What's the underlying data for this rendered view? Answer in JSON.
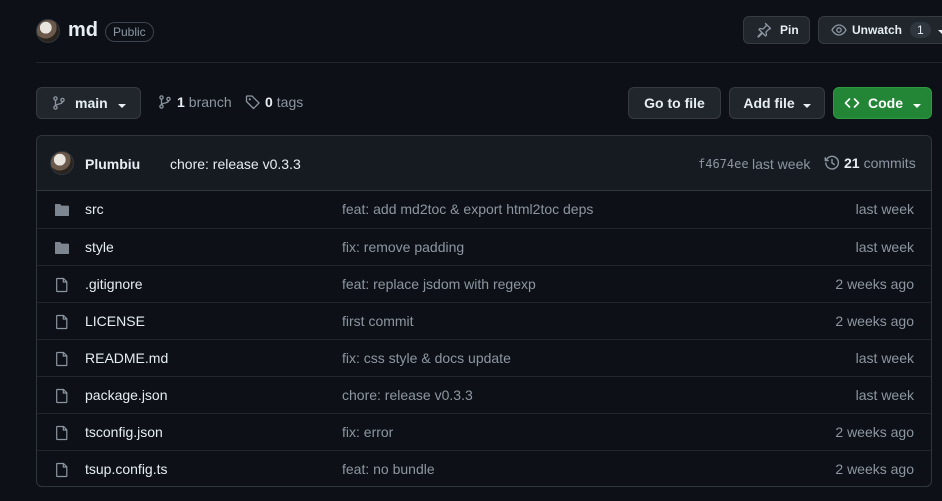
{
  "repo": {
    "name": "md",
    "visibility": "Public"
  },
  "header_actions": {
    "pin_label": "Pin",
    "unwatch_label": "Unwatch",
    "watch_count": "1"
  },
  "toolbar": {
    "branch_selector": "main",
    "branches_count": "1",
    "branches_label": "branch",
    "tags_count": "0",
    "tags_label": "tags",
    "go_to_file": "Go to file",
    "add_file": "Add file",
    "code": "Code"
  },
  "latest_commit": {
    "author": "Plumbiu",
    "message": "chore: release v0.3.3",
    "sha": "f4674ee",
    "age": "last week",
    "commits_count": "21",
    "commits_label": "commits"
  },
  "files": [
    {
      "type": "dir",
      "name": "src",
      "message": "feat: add md2toc & export html2toc deps",
      "age": "last week"
    },
    {
      "type": "dir",
      "name": "style",
      "message": "fix: remove padding",
      "age": "last week"
    },
    {
      "type": "file",
      "name": ".gitignore",
      "message": "feat: replace jsdom with regexp",
      "age": "2 weeks ago"
    },
    {
      "type": "file",
      "name": "LICENSE",
      "message": "first commit",
      "age": "2 weeks ago"
    },
    {
      "type": "file",
      "name": "README.md",
      "message": "fix: css style & docs update",
      "age": "last week"
    },
    {
      "type": "file",
      "name": "package.json",
      "message": "chore: release v0.3.3",
      "age": "last week"
    },
    {
      "type": "file",
      "name": "tsconfig.json",
      "message": "fix: error",
      "age": "2 weeks ago"
    },
    {
      "type": "file",
      "name": "tsup.config.ts",
      "message": "feat: no bundle",
      "age": "2 weeks ago"
    }
  ],
  "colors": {
    "background": "#0d1117",
    "border": "#30363d",
    "muted_text": "#8d96a0",
    "primary_button": "#238636",
    "folder_icon": "#7d8590"
  }
}
